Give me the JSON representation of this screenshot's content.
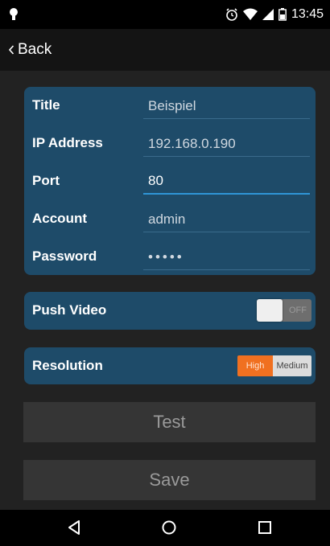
{
  "status_bar": {
    "time": "13:45",
    "icons": [
      "notification-icon",
      "alarm-icon",
      "wifi-icon",
      "signal-icon",
      "battery-icon"
    ]
  },
  "action_bar": {
    "back_label": "Back"
  },
  "form": {
    "title": {
      "label": "Title",
      "value": "Beispiel"
    },
    "ip": {
      "label": "IP Address",
      "value": "192.168.0.190"
    },
    "port": {
      "label": "Port",
      "value": "80"
    },
    "account": {
      "label": "Account",
      "value": "admin"
    },
    "password": {
      "label": "Password",
      "value": "•••••"
    }
  },
  "push_video": {
    "label": "Push Video",
    "toggle_state": "OFF"
  },
  "resolution": {
    "label": "Resolution",
    "options": [
      "High",
      "Medium"
    ],
    "selected": "High"
  },
  "buttons": {
    "test": "Test",
    "save": "Save"
  },
  "colors": {
    "card": "#1e4b69",
    "accent_orange": "#f07020",
    "focus_blue": "#2f95d6",
    "background": "#222222"
  }
}
